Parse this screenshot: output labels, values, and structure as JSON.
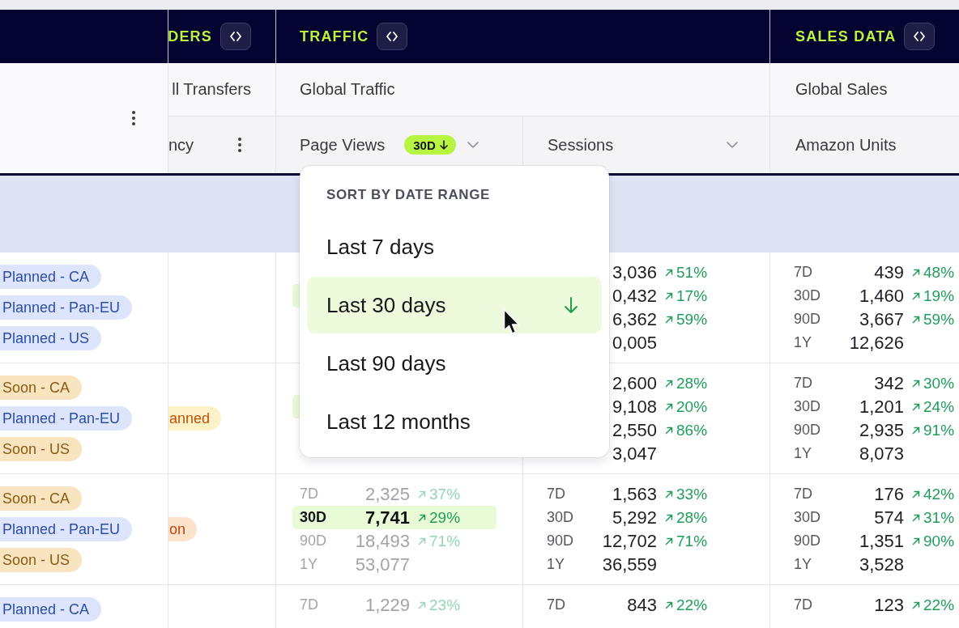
{
  "table": {
    "column_groups": [
      {
        "title": "DERS"
      },
      {
        "title": "TRAFFIC"
      },
      {
        "title": "SALES DATA"
      }
    ],
    "subgroups": [
      {
        "title": "ll Transfers"
      },
      {
        "title": "Global Traffic"
      },
      {
        "title": "Global Sales"
      }
    ],
    "columns": [
      {
        "label": "ncy",
        "kind": "menu"
      },
      {
        "label": "Page Views",
        "kind": "sortable",
        "sort_badge": "30D"
      },
      {
        "label": "Sessions",
        "kind": "sortable"
      },
      {
        "label": "Amazon Units",
        "kind": "plain"
      }
    ],
    "rows": [
      {
        "tags": [
          {
            "text": "Planned - CA",
            "kind": "planned"
          },
          {
            "text": "Planned - Pan-EU",
            "kind": "planned"
          },
          {
            "text": "Planned - US",
            "kind": "planned"
          }
        ],
        "page_views": [
          {
            "selected": false
          },
          {
            "selected": true
          }
        ],
        "sessions": [
          {
            "value": "3,036",
            "change": "51%"
          },
          {
            "value": "0,432",
            "change": "17%"
          },
          {
            "value": "6,362",
            "change": "59%"
          },
          {
            "value": "0,005"
          }
        ],
        "amazon_units": [
          {
            "label": "7D",
            "value": "439",
            "change": "48%"
          },
          {
            "label": "30D",
            "value": "1,460",
            "change": "19%"
          },
          {
            "label": "90D",
            "value": "3,667",
            "change": "59%"
          },
          {
            "label": "1Y",
            "value": "12,626"
          }
        ]
      },
      {
        "tags": [
          {
            "text": "Soon - CA",
            "kind": "soon"
          },
          {
            "text": "Planned - Pan-EU",
            "kind": "planned"
          },
          {
            "text": "Soon - US",
            "kind": "soon"
          }
        ],
        "status": {
          "text": "anned",
          "kind": "planned"
        },
        "page_views": [
          {
            "selected": false
          },
          {
            "selected": true
          }
        ],
        "sessions": [
          {
            "value": "2,600",
            "change": "28%"
          },
          {
            "value": "9,108",
            "change": "20%"
          },
          {
            "value": "2,550",
            "change": "86%"
          },
          {
            "value": "3,047"
          }
        ],
        "amazon_units": [
          {
            "label": "7D",
            "value": "342",
            "change": "30%"
          },
          {
            "label": "30D",
            "value": "1,201",
            "change": "24%"
          },
          {
            "label": "90D",
            "value": "2,935",
            "change": "91%"
          },
          {
            "label": "1Y",
            "value": "8,073"
          }
        ]
      },
      {
        "tags": [
          {
            "text": "Soon - CA",
            "kind": "soon"
          },
          {
            "text": "Planned - Pan-EU",
            "kind": "planned"
          },
          {
            "text": "Soon - US",
            "kind": "soon"
          }
        ],
        "status": {
          "text": "on",
          "kind": "soon"
        },
        "page_views": [
          {
            "label": "7D",
            "value": "2,325",
            "change": "37%",
            "selected": false
          },
          {
            "label": "30D",
            "value": "7,741",
            "change": "29%",
            "selected": true
          },
          {
            "label": "90D",
            "value": "18,493",
            "change": "71%",
            "selected": false
          },
          {
            "label": "1Y",
            "value": "53,077",
            "selected": false
          }
        ],
        "sessions": [
          {
            "label": "7D",
            "value": "1,563",
            "change": "33%"
          },
          {
            "label": "30D",
            "value": "5,292",
            "change": "28%"
          },
          {
            "label": "90D",
            "value": "12,702",
            "change": "71%"
          },
          {
            "label": "1Y",
            "value": "36,559"
          }
        ],
        "amazon_units": [
          {
            "label": "7D",
            "value": "176",
            "change": "42%"
          },
          {
            "label": "30D",
            "value": "574",
            "change": "31%"
          },
          {
            "label": "90D",
            "value": "1,351",
            "change": "90%"
          },
          {
            "label": "1Y",
            "value": "3,528"
          }
        ]
      },
      {
        "tags": [
          {
            "text": "Planned - CA",
            "kind": "planned"
          }
        ],
        "page_views": [
          {
            "label": "7D",
            "value": "1,229",
            "change": "23%",
            "selected": false
          }
        ],
        "sessions": [
          {
            "label": "7D",
            "value": "843",
            "change": "22%"
          }
        ],
        "amazon_units": [
          {
            "label": "7D",
            "value": "123",
            "change": "22%"
          }
        ]
      }
    ]
  },
  "sort_menu": {
    "heading": "SORT BY DATE RANGE",
    "options": [
      {
        "label": "Last 7 days",
        "selected": false
      },
      {
        "label": "Last 30 days",
        "selected": true
      },
      {
        "label": "Last 90 days",
        "selected": false
      },
      {
        "label": "Last 12 months",
        "selected": false
      }
    ]
  }
}
